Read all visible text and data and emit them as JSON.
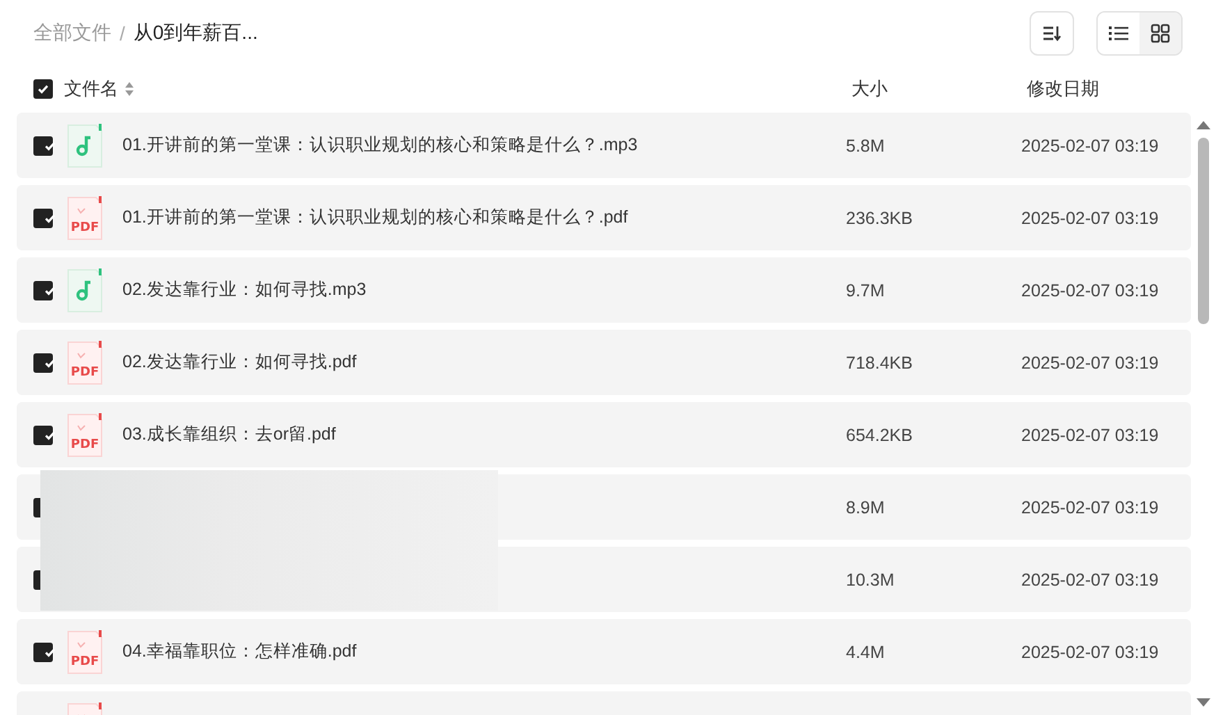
{
  "breadcrumb": [
    {
      "label": "全部文件",
      "current": false
    },
    {
      "label": "从0到年薪百...",
      "current": true
    }
  ],
  "separator": "/",
  "view_toggle": [
    {
      "kind": "list",
      "selected": true
    },
    {
      "kind": "grid",
      "selected": false
    }
  ],
  "table": {
    "select_all": {
      "checked": true
    },
    "columns": [
      "文件名",
      "大小",
      "修改日期"
    ],
    "rows": [
      {
        "kind": "audio",
        "checked": true,
        "name": "01.开讲前的第一堂课：认识职业规划的核心和策略是什么？.mp3",
        "size": "5.8M",
        "date": "2025-02-07 03:19"
      },
      {
        "kind": "pdf",
        "icon_text": "PDF",
        "checked": true,
        "name": "01.开讲前的第一堂课：认识职业规划的核心和策略是什么？.pdf",
        "size": "236.3KB",
        "date": "2025-02-07 03:19"
      },
      {
        "kind": "audio",
        "checked": true,
        "name": "02.发达靠行业：如何寻找.mp3",
        "size": "9.7M",
        "date": "2025-02-07 03:19"
      },
      {
        "kind": "pdf",
        "icon_text": "PDF",
        "checked": true,
        "name": "02.发达靠行业：如何寻找.pdf",
        "size": "718.4KB",
        "date": "2025-02-07 03:19"
      },
      {
        "kind": "pdf",
        "icon_text": "PDF",
        "checked": true,
        "name": "03.成长靠组织：去or留.pdf",
        "size": "654.2KB",
        "date": "2025-02-07 03:19"
      },
      {
        "kind": "hidden",
        "checked": true,
        "size": "8.9M",
        "date": "2025-02-07 03:19"
      },
      {
        "kind": "hidden",
        "checked": true,
        "size": "10.3M",
        "date": "2025-02-07 03:19"
      },
      {
        "kind": "pdf",
        "icon_text": "PDF",
        "checked": true,
        "name": "04.幸福靠职位：怎样准确.pdf",
        "size": "4.4M",
        "date": "2025-02-07 03:19"
      },
      {
        "kind": "pdf"
      }
    ]
  }
}
